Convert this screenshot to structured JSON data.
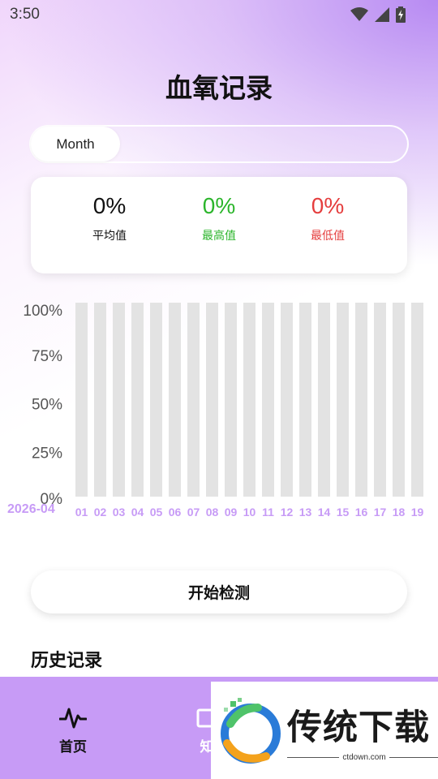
{
  "status_bar": {
    "time": "3:50"
  },
  "header": {
    "title": "血氧记录"
  },
  "tabs": {
    "active": "Month"
  },
  "stats": [
    {
      "value": "0%",
      "label": "平均值",
      "color": "#111111"
    },
    {
      "value": "0%",
      "label": "最高值",
      "color": "#2bb52b"
    },
    {
      "value": "0%",
      "label": "最低值",
      "color": "#e53e3e"
    }
  ],
  "chart_data": {
    "type": "bar",
    "month_label": "2026-04",
    "categories": [
      "01",
      "02",
      "03",
      "04",
      "05",
      "06",
      "07",
      "08",
      "09",
      "10",
      "11",
      "12",
      "13",
      "14",
      "15",
      "16",
      "17",
      "18",
      "19"
    ],
    "values": [
      0,
      0,
      0,
      0,
      0,
      0,
      0,
      0,
      0,
      0,
      0,
      0,
      0,
      0,
      0,
      0,
      0,
      0,
      0
    ],
    "ylim": [
      0,
      100
    ],
    "yticks": [
      "100%",
      "75%",
      "50%",
      "25%",
      "0%"
    ],
    "bar_background_color": "#e3e3e3",
    "bar_color": "#b07ff0",
    "label_color": "#c79bf6"
  },
  "actions": {
    "start_button": "开始检测"
  },
  "history": {
    "title": "历史记录"
  },
  "bottom_nav": {
    "home_label": "首页",
    "second_label_partial": "知"
  },
  "watermark": {
    "text": "传统下载",
    "url": "ctdown.com"
  }
}
